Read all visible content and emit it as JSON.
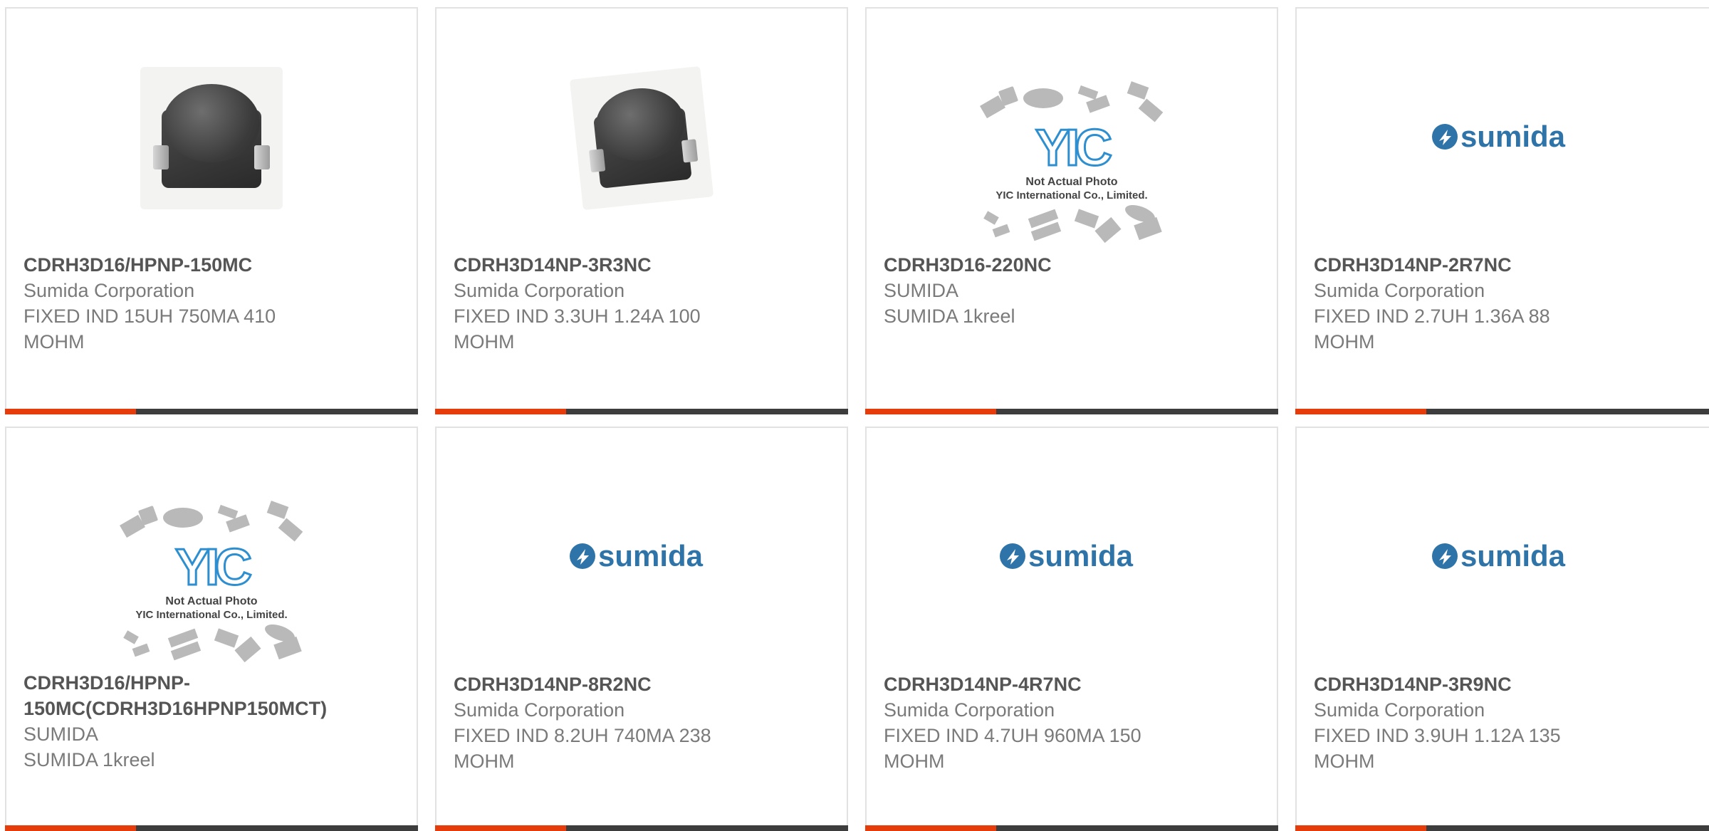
{
  "colors": {
    "accent": "#e63b0a",
    "bar": "#3d3d3d",
    "title_text": "#555555",
    "body_text": "#7a7a7a",
    "sumida_blue": "#2f74a8",
    "yic_blue": "#2e8fd0"
  },
  "placeholder_logo": {
    "brand": "YIC",
    "line1": "Not Actual Photo",
    "line2": "YIC International Co., Limited."
  },
  "sumida_logo": {
    "wordmark": "sumida"
  },
  "products": [
    {
      "image": "inductor-photo",
      "part_number": "CDRH3D16/HPNP-150MC",
      "manufacturer": "Sumida Corporation",
      "description_line1": "FIXED IND 15UH 750MA 410",
      "description_line2": "MOHM"
    },
    {
      "image": "inductor-photo",
      "part_number": "CDRH3D14NP-3R3NC",
      "manufacturer": "Sumida Corporation",
      "description_line1": "FIXED IND 3.3UH 1.24A 100",
      "description_line2": "MOHM"
    },
    {
      "image": "not-actual-photo-placeholder",
      "part_number": "CDRH3D16-220NC",
      "manufacturer": "SUMIDA",
      "description_line1": "SUMIDA 1kreel",
      "description_line2": ""
    },
    {
      "image": "sumida-logo",
      "part_number": "CDRH3D14NP-2R7NC",
      "manufacturer": "Sumida Corporation",
      "description_line1": "FIXED IND 2.7UH 1.36A 88",
      "description_line2": "MOHM"
    },
    {
      "image": "not-actual-photo-placeholder",
      "part_number_line1": "CDRH3D16/HPNP-",
      "part_number_line2": "150MC(CDRH3D16HPNP150MCT)",
      "manufacturer": "SUMIDA",
      "description_line1": "SUMIDA 1kreel",
      "description_line2": ""
    },
    {
      "image": "sumida-logo",
      "part_number": "CDRH3D14NP-8R2NC",
      "manufacturer": "Sumida Corporation",
      "description_line1": "FIXED IND 8.2UH 740MA 238",
      "description_line2": "MOHM"
    },
    {
      "image": "sumida-logo",
      "part_number": "CDRH3D14NP-4R7NC",
      "manufacturer": "Sumida Corporation",
      "description_line1": "FIXED IND 4.7UH 960MA 150",
      "description_line2": "MOHM"
    },
    {
      "image": "sumida-logo",
      "part_number": "CDRH3D14NP-3R9NC",
      "manufacturer": "Sumida Corporation",
      "description_line1": "FIXED IND 3.9UH 1.12A 135",
      "description_line2": "MOHM"
    }
  ]
}
